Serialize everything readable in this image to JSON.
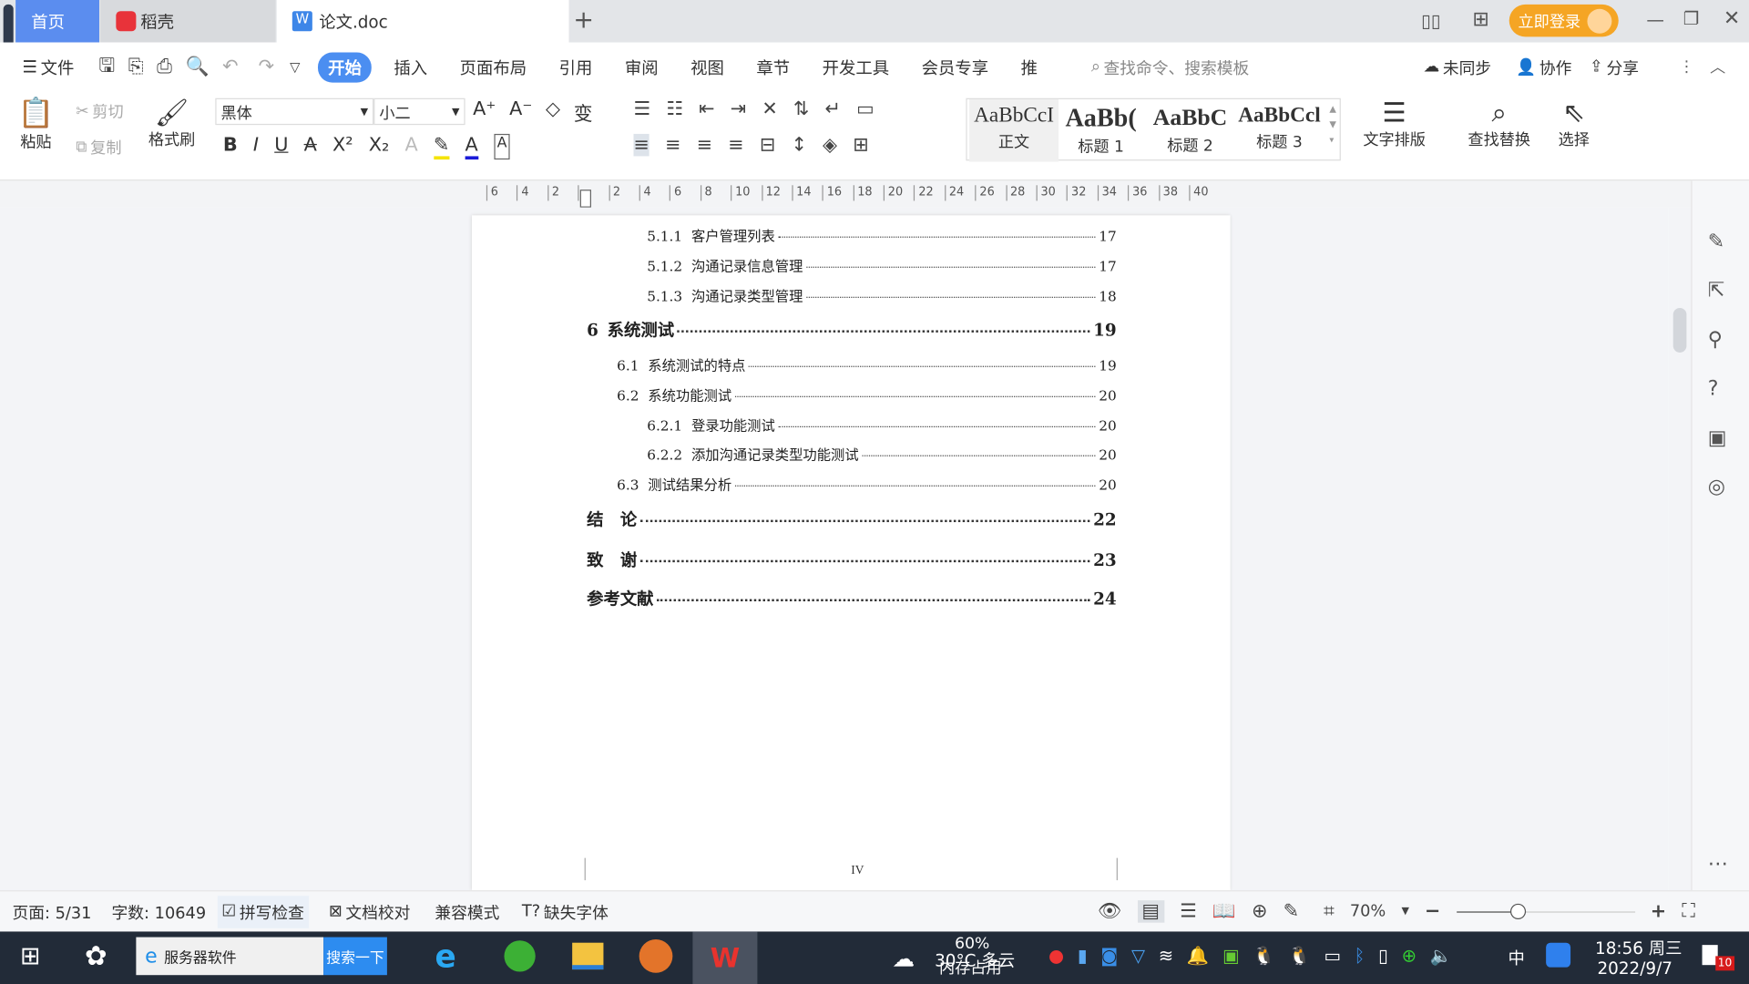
{
  "titlebar": {
    "tabs": [
      {
        "label": "首页"
      },
      {
        "label": "稻壳"
      },
      {
        "label": "论文.doc"
      }
    ],
    "new_tab": "+",
    "login": "立即登录"
  },
  "menubar": {
    "file": "文件",
    "tabs": [
      "开始",
      "插入",
      "页面布局",
      "引用",
      "审阅",
      "视图",
      "章节",
      "开发工具",
      "会员专享",
      "推"
    ],
    "active_tab": "开始",
    "search_placeholder": "查找命令、搜索模板",
    "sync": "未同步",
    "collab": "协作",
    "share": "分享"
  },
  "ribbon": {
    "paste": "粘贴",
    "cut": "剪切",
    "copy": "复制",
    "format_painter": "格式刷",
    "font": "黑体",
    "font_size": "小二",
    "styles": [
      {
        "sample": "AaBbCcI",
        "label": "正文"
      },
      {
        "sample": "AaBb(",
        "label": "标题 1"
      },
      {
        "sample": "AaBbC",
        "label": "标题 2"
      },
      {
        "sample": "AaBbCcl",
        "label": "标题 3"
      }
    ],
    "text_layout": "文字排版",
    "find_replace": "查找替换",
    "select": "选择"
  },
  "ruler": {
    "ticks": [
      "6",
      "4",
      "2",
      "",
      "2",
      "4",
      "6",
      "8",
      "10",
      "12",
      "14",
      "16",
      "18",
      "20",
      "22",
      "24",
      "26",
      "28",
      "30",
      "32",
      "34",
      "36",
      "38",
      "40"
    ]
  },
  "document": {
    "toc": [
      {
        "level": 3,
        "num": "5.1.1",
        "title": "客户管理列表",
        "page": "17"
      },
      {
        "level": 3,
        "num": "5.1.2",
        "title": "沟通记录信息管理",
        "page": "17"
      },
      {
        "level": 3,
        "num": "5.1.3",
        "title": "沟通记录类型管理",
        "page": "18"
      },
      {
        "level": 1,
        "num": "6",
        "title": "系统测试",
        "page": "19"
      },
      {
        "level": 2,
        "num": "6.1",
        "title": "系统测试的特点",
        "page": "19"
      },
      {
        "level": 2,
        "num": "6.2",
        "title": "系统功能测试",
        "page": "20"
      },
      {
        "level": 3,
        "num": "6.2.1",
        "title": "登录功能测试",
        "page": "20"
      },
      {
        "level": 3,
        "num": "6.2.2",
        "title": "添加沟通记录类型功能测试",
        "page": "20"
      },
      {
        "level": 2,
        "num": "6.3",
        "title": "测试结果分析",
        "page": "20"
      },
      {
        "level": 1,
        "num": "",
        "title": "结　论",
        "page": "22"
      },
      {
        "level": 1,
        "num": "",
        "title": "致　谢",
        "page": "23"
      },
      {
        "level": 1,
        "num": "",
        "title": "参考文献",
        "page": "24"
      }
    ],
    "footer_page": "IV"
  },
  "statusbar": {
    "page": "页面: 5/31",
    "words": "字数: 10649",
    "spell": "拼写检查",
    "proof": "文档校对",
    "compat": "兼容模式",
    "missing_font": "缺失字体",
    "zoom": "70%",
    "zoom_level": 70
  },
  "taskbar": {
    "search_value": "服务器软件",
    "search_btn": "搜索一下",
    "weather": "30°C 多云",
    "memory_pct": "60%",
    "memory_label": "内存占用",
    "ime": "中",
    "time": "18:56 周三",
    "date": "2022/9/7",
    "notifications": "10"
  },
  "colors": {
    "accent": "#4b8ef1",
    "login": "#f5a524",
    "taskbar": "#222b38"
  }
}
